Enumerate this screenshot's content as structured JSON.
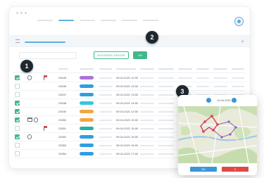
{
  "header": {
    "nav_items": [
      "",
      "",
      "",
      "",
      "",
      "",
      "",
      ""
    ]
  },
  "filter": {
    "pill_label": "ASSIGNED DRIVER",
    "action_label": "ON"
  },
  "markers": [
    "1",
    "2",
    "3"
  ],
  "tag_colors": {
    "purple": "#a974d8",
    "blue": "#2f9ee0",
    "cyan": "#35c6e0",
    "orange": "#f2a640",
    "teal": "#23b2a4"
  },
  "rows": [
    {
      "checked": true,
      "icons": [
        "clip-icon",
        "flag-icon"
      ],
      "code": "23045",
      "tag": "purple",
      "time": "09.04.2021 12:00"
    },
    {
      "checked": false,
      "icons": [],
      "code": "23046",
      "tag": "blue",
      "time": "09.04.2021 13:00"
    },
    {
      "checked": false,
      "icons": [],
      "code": "23047",
      "tag": "blue",
      "time": "09.04.2021 13:00"
    },
    {
      "checked": true,
      "icons": [],
      "code": "23048",
      "tag": "cyan",
      "time": "09.04.2021 14:00"
    },
    {
      "checked": true,
      "icons": [],
      "code": "23049",
      "tag": "orange",
      "time": "09.04.2021 14:00"
    },
    {
      "checked": true,
      "icons": [
        "calendar-icon",
        "clip-icon"
      ],
      "code": "23050",
      "tag": "orange",
      "time": "09.04.2021 15:00"
    },
    {
      "checked": false,
      "icons": [
        "flag-icon"
      ],
      "code": "23051",
      "tag": "teal",
      "time": "09.04.2021 15:00"
    },
    {
      "checked": true,
      "icons": [
        "clip-icon"
      ],
      "code": "23052",
      "tag": "blue",
      "time": "09.04.2021 16:00"
    },
    {
      "checked": false,
      "icons": [],
      "code": "23053",
      "tag": "blue",
      "time": "09.04.2021 16:00"
    },
    {
      "checked": false,
      "icons": [],
      "code": "23054",
      "tag": "blue",
      "time": "09.04.2021 17:00"
    }
  ],
  "map_panel": {
    "date": "10.04.2021",
    "button_left": "OK",
    "button_right": "X"
  }
}
